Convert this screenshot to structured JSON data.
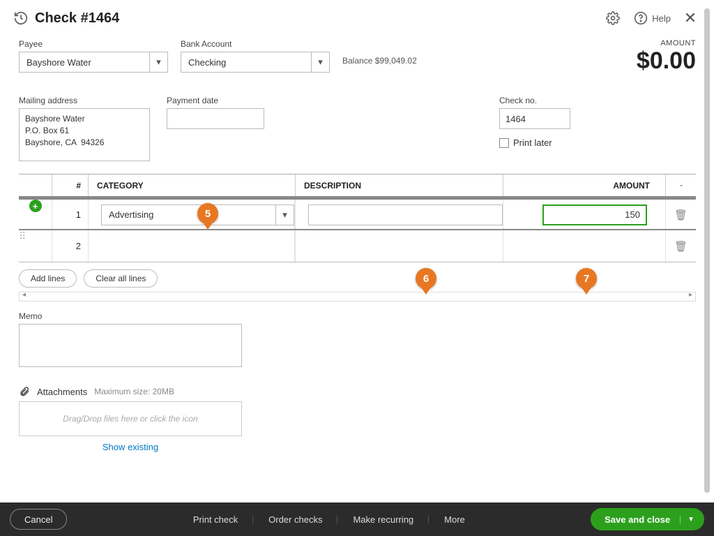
{
  "header": {
    "title": "Check #1464",
    "help_label": "Help"
  },
  "payee": {
    "label": "Payee",
    "value": "Bayshore Water"
  },
  "bank_account": {
    "label": "Bank Account",
    "value": "Checking"
  },
  "balance": {
    "label": "Balance",
    "value": "$99,049.02"
  },
  "amount": {
    "label": "AMOUNT",
    "value": "$0.00"
  },
  "mailing": {
    "label": "Mailing address",
    "value": "Bayshore Water\nP.O. Box 61\nBayshore, CA  94326"
  },
  "payment_date": {
    "label": "Payment date",
    "value": ""
  },
  "check_no": {
    "label": "Check no.",
    "value": "1464"
  },
  "print_later": {
    "label": "Print later",
    "checked": false
  },
  "grid": {
    "headers": {
      "num": "#",
      "category": "CATEGORY",
      "description": "DESCRIPTION",
      "amount": "AMOUNT"
    },
    "rows": [
      {
        "num": "1",
        "category": "Advertising",
        "description": "",
        "amount": "150"
      },
      {
        "num": "2",
        "category": "",
        "description": "",
        "amount": ""
      }
    ],
    "add_lines": "Add lines",
    "clear_all": "Clear all lines"
  },
  "memo": {
    "label": "Memo",
    "value": ""
  },
  "attachments": {
    "label": "Attachments",
    "max": "Maximum size: 20MB",
    "drop_hint": "Drag/Drop files here or click the icon",
    "show_existing": "Show existing"
  },
  "footer": {
    "cancel": "Cancel",
    "print_check": "Print check",
    "order_checks": "Order checks",
    "make_recurring": "Make recurring",
    "more": "More",
    "save": "Save and close"
  },
  "callouts": {
    "c5": "5",
    "c6": "6",
    "c7": "7"
  }
}
